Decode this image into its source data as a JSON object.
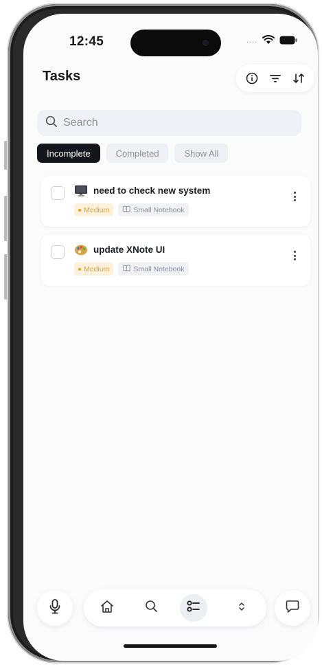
{
  "status_bar": {
    "time": "12:45"
  },
  "header": {
    "title": "Tasks",
    "actions": [
      "info-icon",
      "filter-icon",
      "sort-icon"
    ]
  },
  "search": {
    "placeholder": "Search"
  },
  "filters": [
    {
      "label": "Incomplete",
      "active": true
    },
    {
      "label": "Completed",
      "active": false
    },
    {
      "label": "Show All",
      "active": false
    }
  ],
  "tasks": [
    {
      "icon": "computer-icon",
      "title": "need to check new system",
      "priority": "Medium",
      "notebook": "Small Notebook",
      "checked": false
    },
    {
      "icon": "palette-icon",
      "title": "update XNote UI",
      "priority": "Medium",
      "notebook": "Small Notebook",
      "checked": false
    }
  ],
  "bottom_bar": {
    "left": "microphone-icon",
    "nav": [
      "home-icon",
      "search-icon",
      "tasks-icon",
      "expand-icon"
    ],
    "active": "tasks-icon",
    "right": "chat-icon"
  },
  "colors": {
    "accent_dark": "#15161c",
    "priority": "#e6a31e",
    "priority_bg": "#fdf1dc"
  }
}
